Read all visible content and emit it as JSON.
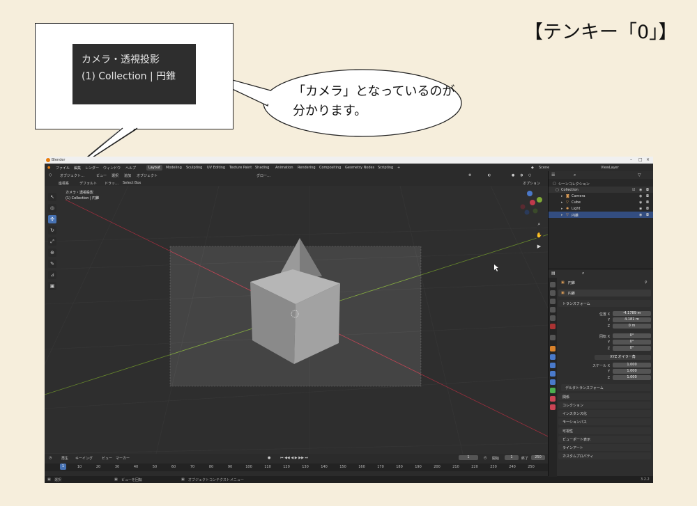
{
  "heading": "【テンキー「0」】",
  "callout": {
    "zoom_line1": "カメラ・透視投影",
    "zoom_line2": "(1) Collection | 円錐",
    "bubble_line1": "「カメラ」となっているのが",
    "bubble_line2": "分かります。"
  },
  "window": {
    "title": "Blender",
    "menu": [
      "ファイル",
      "編集",
      "レンダー",
      "ウィンドウ",
      "ヘルプ"
    ],
    "workspaces": [
      "Layout",
      "Modeling",
      "Sculpting",
      "UV Editing",
      "Texture Paint",
      "Shading",
      "Animation",
      "Rendering",
      "Compositing",
      "Geometry Nodes",
      "Scripting"
    ],
    "active_workspace": "Layout",
    "scene": "Scene",
    "view_layer": "ViewLayer",
    "header": {
      "mode": "オブジェクト…",
      "items": [
        "ビュー",
        "選択",
        "追加",
        "オブジェクト"
      ],
      "pivot": "グロー…",
      "coord_label": "座標系",
      "coord_value": "デフォルト",
      "drag_label": "ドラッ…",
      "select_box": "Select Box",
      "options": "オプション"
    },
    "viewport_info": {
      "line1": "カメラ・透視投影",
      "line2": "(1) Collection | 円錐"
    },
    "timeline": {
      "items": [
        "再生",
        "キーイング",
        "ビュー",
        "マーカー"
      ],
      "frame_current": "1",
      "start_label": "開始",
      "start": "1",
      "end_label": "終了",
      "end": "250",
      "ruler": [
        "10",
        "20",
        "30",
        "40",
        "50",
        "60",
        "70",
        "80",
        "90",
        "100",
        "110",
        "120",
        "130",
        "140",
        "150",
        "160",
        "170",
        "180",
        "190",
        "200",
        "210",
        "220",
        "230",
        "240",
        "250"
      ]
    },
    "statusbar": {
      "select": "選択",
      "rotate": "ビューを回転",
      "context": "オブジェクトコンテクストメニュー",
      "version": "3.2.2"
    },
    "outliner": {
      "root": "シーンコレクション",
      "collection": "Collection",
      "objects": [
        "Camera",
        "Cube",
        "Light",
        "円錐"
      ]
    },
    "properties": {
      "object_name": "円錐",
      "data_name": "円錐",
      "transform_title": "トランスフォーム",
      "location_label": "位置 X",
      "location": [
        "-4.1789 m",
        "4.181 m",
        "0 m"
      ],
      "rotation_label": "回転 X",
      "rotation": [
        "0°",
        "0°",
        "0°"
      ],
      "mode_label": "モード",
      "mode_value": "XYZ オイラー角",
      "scale_label": "スケール X",
      "scale": [
        "1.000",
        "1.000",
        "1.000"
      ],
      "axis_y": "Y",
      "axis_z": "Z",
      "sections": [
        "デルタトランスフォーム",
        "関係",
        "コレクション",
        "インスタンス化",
        "モーションパス",
        "可視性",
        "ビューポート表示",
        "ラインアート",
        "カスタムプロパティ"
      ]
    }
  },
  "colors": {
    "page_bg": "#f6eedc",
    "viewport_bg": "#393939",
    "accent": "#4772b3",
    "x_axis": "#c0394b",
    "y_axis": "#7fa836"
  }
}
